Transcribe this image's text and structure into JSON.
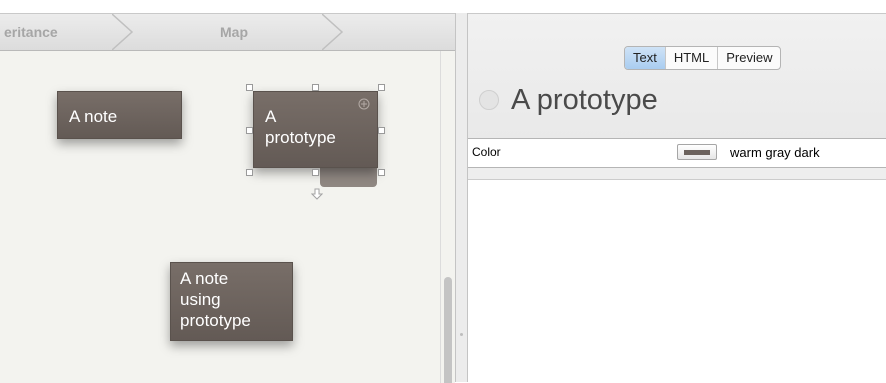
{
  "breadcrumb": {
    "items": [
      "eritance",
      "Map"
    ]
  },
  "map": {
    "notes": [
      {
        "lines": [
          "A note"
        ]
      },
      {
        "lines": [
          "A",
          "prototype"
        ]
      },
      {
        "lines": [
          "A note",
          "using",
          "prototype"
        ]
      }
    ]
  },
  "view_tabs": {
    "items": [
      "Text",
      "HTML",
      "Preview"
    ],
    "selected": "Text"
  },
  "note": {
    "title": "A prototype"
  },
  "attributes": {
    "name": "Color",
    "value": "warm gray dark",
    "swatch_color": "#6b625d"
  },
  "colors": {
    "note_fill": "#6e645f",
    "tab_active": "#b9d7f3"
  }
}
